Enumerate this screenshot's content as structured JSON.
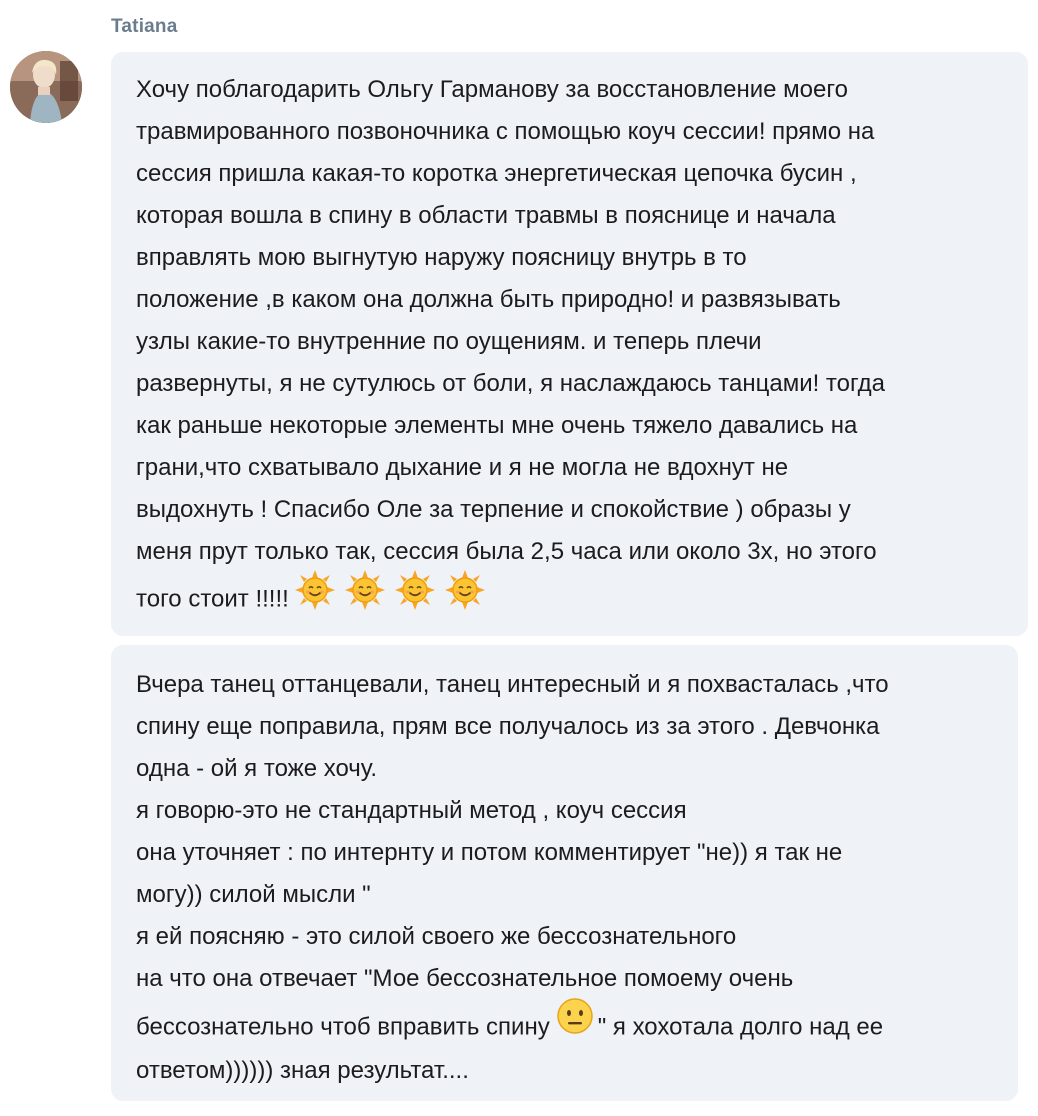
{
  "post": {
    "author": "Tatiana",
    "avatar_icon": "user-photo-avatar"
  },
  "messages": [
    {
      "lines": [
        "Хочу поблагодарить Ольгу Гарманову за восстановление моего",
        "травмированного позвоночника с помощью коуч сессии! прямо на",
        "сессия пришла какая-то коротка энергетическая цепочка бусин ,",
        "которая вошла в спину в области травмы в пояснице и начала",
        "вправлять мою выгнутую наружу поясницу внутрь в то",
        "положение ,в каком она должна быть природно! и развязывать",
        "узлы какие-то внутренние по оущениям. и теперь плечи",
        "развернуты, я не сутулюсь от боли, я наслаждаюсь танцами! тогда",
        "как раньше некоторые элементы мне очень тяжело давались на",
        "грани,что схватывало дыхание и я не могла не вдохнут не",
        "выдохнуть ! Спасибо Оле за терпение и спокойствие ) образы у",
        "меня прут только так, сессия была 2,5 часа или около 3х, но этого",
        "того стоит !!!!!"
      ],
      "emojis": [
        "smiling-sun-emoji",
        "smiling-sun-emoji",
        "smiling-sun-emoji",
        "smiling-sun-emoji"
      ]
    },
    {
      "lines": [
        "Вчера танец оттанцевали, танец интересный и я похвасталась ,что",
        "спину еще поправила, прям все получалось из за этого . Девчонка",
        "одна - ой я тоже хочу.",
        "я говорю-это не стандартный метод , коуч сессия",
        "она уточняет : по интернту и потом комментирует \"не)) я так не",
        "могу)) силой мысли \"",
        "я ей поясняю  - это силой своего же бессознательного",
        "на что она отвечает \"Мое бессознательное помоему  очень",
        "бессознательно чтоб вправить спину",
        "\" я хохотала долго над ее",
        "ответом)))))) зная результат...."
      ],
      "emojis": [
        "neutral-face-emoji"
      ]
    }
  ],
  "colors": {
    "author": "#6c7c8f",
    "bubble_bg": "#eff2f6",
    "text": "#1c1c1e"
  }
}
